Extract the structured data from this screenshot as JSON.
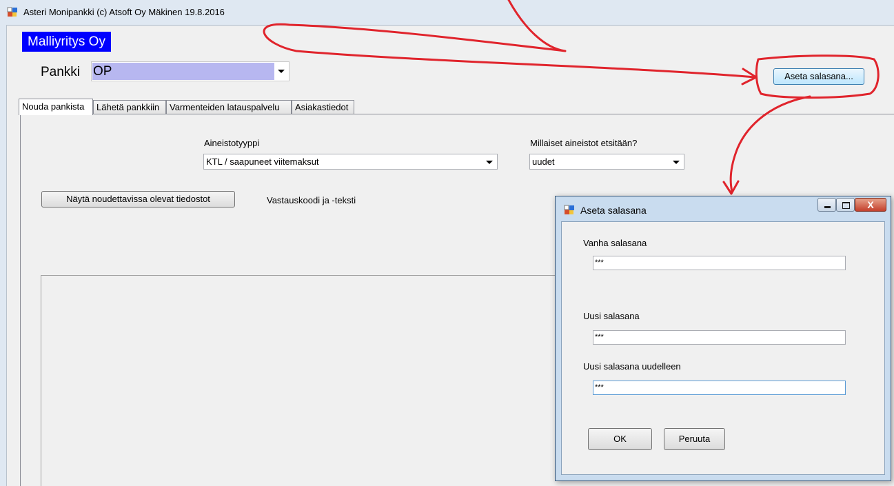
{
  "window": {
    "title": "Asteri Monipankki  (c) Atsoft Oy Mäkinen 19.8.2016"
  },
  "company": {
    "name": "Malliyritys Oy"
  },
  "bank": {
    "label": "Pankki",
    "value": "OP"
  },
  "toolbar": {
    "set_password_label": "Aseta salasana..."
  },
  "tabs": [
    {
      "label": "Nouda pankista",
      "active": true
    },
    {
      "label": "Lähetä pankkiin",
      "active": false
    },
    {
      "label": "Varmenteiden latauspalvelu",
      "active": false
    },
    {
      "label": "Asiakastiedot",
      "active": false
    }
  ],
  "fetch": {
    "material_type_label": "Aineistotyyppi",
    "material_type_value": "KTL / saapuneet viitemaksut",
    "search_label": "Millaiset aineistot etsitään?",
    "search_value": "uudet",
    "show_button_label": "Näytä noudettavissa olevat tiedostot",
    "response_label": "Vastauskoodi ja -teksti"
  },
  "dialog": {
    "title": "Aseta salasana",
    "old_label": "Vanha salasana",
    "old_value": "***",
    "new_label": "Uusi salasana",
    "new_value": "***",
    "repeat_label": "Uusi salasana uudelleen",
    "repeat_value": "***",
    "ok_label": "OK",
    "cancel_label": "Peruuta",
    "close_glyph": "X"
  },
  "colors": {
    "annotation": "#e0242c",
    "company_bg": "#0000ff",
    "bank_highlight": "#b7b7f0"
  }
}
